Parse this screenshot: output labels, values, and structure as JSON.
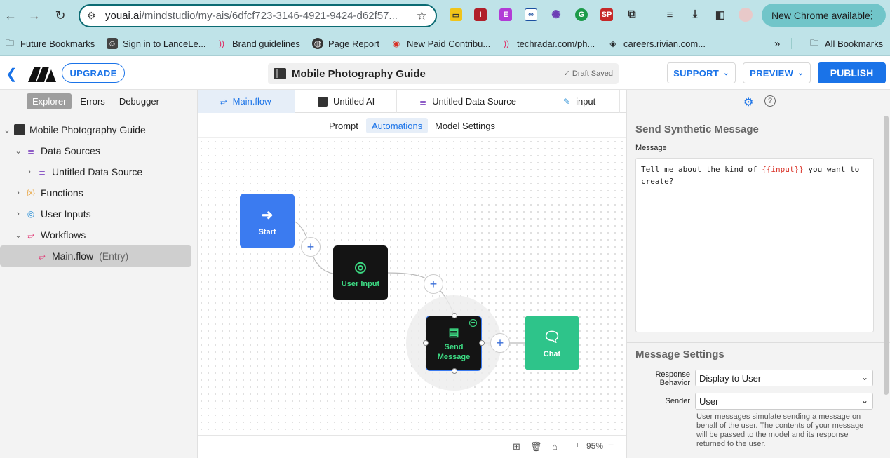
{
  "browser": {
    "url_main": "youai.ai",
    "url_rest": "/mindstudio/my-ais/6dfcf723-3146-4921-9424-d62f57...",
    "update_label": "New Chrome available",
    "bookmarks": [
      {
        "label": "Future Bookmarks",
        "icon": "folder-icon"
      },
      {
        "label": "Sign in to LanceLe...",
        "icon": "avatar-icon"
      },
      {
        "label": "Brand guidelines",
        "icon": "rss-icon"
      },
      {
        "label": "Page Report",
        "icon": "globe-icon"
      },
      {
        "label": "New Paid Contribu...",
        "icon": "record-icon"
      },
      {
        "label": "techradar.com/ph...",
        "icon": "rss-icon"
      },
      {
        "label": "careers.rivian.com...",
        "icon": "diamond-icon"
      },
      {
        "label": "All Bookmarks",
        "icon": "folder-icon"
      }
    ]
  },
  "header": {
    "upgrade": "UPGRADE",
    "project_title": "Mobile Photography Guide",
    "saved_status": "✓ Draft Saved",
    "support": "SUPPORT",
    "preview": "PREVIEW",
    "publish": "PUBLISH"
  },
  "sidebar": {
    "tabs": [
      "Explorer",
      "Errors",
      "Debugger"
    ],
    "tree": [
      {
        "label": "Mobile Photography Guide"
      },
      {
        "label": "Data Sources"
      },
      {
        "label": "Untitled Data Source"
      },
      {
        "label": "Functions"
      },
      {
        "label": "User Inputs"
      },
      {
        "label": "Workflows"
      },
      {
        "label": "Main.flow",
        "tag": "(Entry)"
      }
    ]
  },
  "editor": {
    "tabs": [
      "Main.flow",
      "Untitled AI",
      "Untitled Data Source",
      "input"
    ],
    "sub_tabs": [
      "Prompt",
      "Automations",
      "Model Settings"
    ],
    "nodes": {
      "start": "Start",
      "user_input": "User Input",
      "send_message": "Send Message",
      "chat": "Chat"
    },
    "zoom": "95%"
  },
  "right_panel": {
    "section_title": "Send Synthetic Message",
    "message_label": "Message",
    "message_before": "Tell me about the kind of ",
    "message_var": "{{input}}",
    "message_after": " you want to create?",
    "settings_title": "Message Settings",
    "response_behavior_label": "Response Behavior",
    "response_behavior_value": "Display to User",
    "sender_label": "Sender",
    "sender_value": "User",
    "help_text": "User messages simulate sending a message on behalf of the user. The contents of your message will be passed to the model and its response returned to the user."
  },
  "colors": {
    "accent": "#1a73e8",
    "start_node": "#3b7bf0",
    "dark_node": "#141414",
    "chat_node": "#2ec48a",
    "node_text_green": "#3ddc84"
  }
}
